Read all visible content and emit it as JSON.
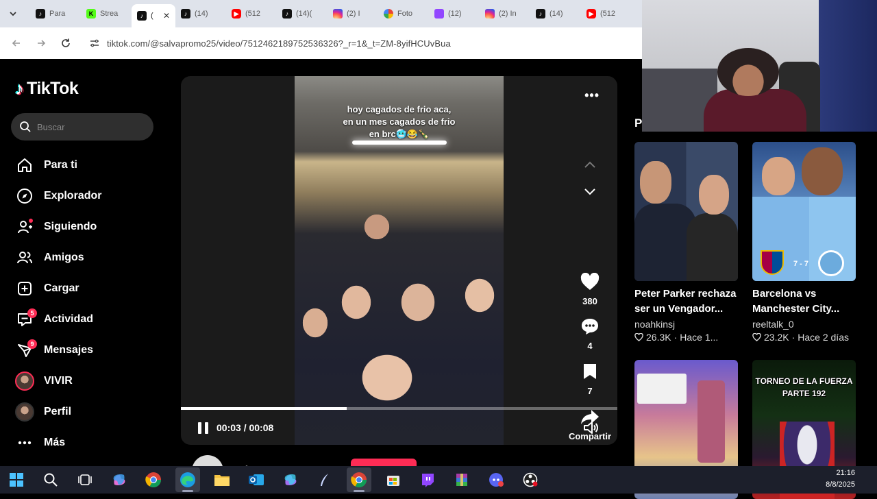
{
  "browser": {
    "tabs": [
      {
        "label": "Para",
        "icon": "tiktok"
      },
      {
        "label": "Strea",
        "icon": "kick"
      },
      {
        "label": "(",
        "icon": "tiktok",
        "active": true
      },
      {
        "label": "(14)",
        "icon": "tiktok"
      },
      {
        "label": "(512",
        "icon": "youtube"
      },
      {
        "label": "(14)(",
        "icon": "tiktok"
      },
      {
        "label": "(2) I",
        "icon": "instagram"
      },
      {
        "label": "Foto",
        "icon": "google-photos"
      },
      {
        "label": "(12)",
        "icon": "twitch"
      },
      {
        "label": "(2) In",
        "icon": "instagram"
      },
      {
        "label": "(14)",
        "icon": "tiktok"
      },
      {
        "label": "(512",
        "icon": "youtube"
      }
    ],
    "url": "tiktok.com/@salvapromo25/video/7512462189752536326?_r=1&_t=ZM-8yifHCUvBua"
  },
  "tiktok": {
    "logo_text": "TikTok",
    "search_placeholder": "Buscar",
    "nav": [
      {
        "label": "Para ti",
        "icon": "home-icon"
      },
      {
        "label": "Explorador",
        "icon": "compass-icon"
      },
      {
        "label": "Siguiendo",
        "icon": "following-icon",
        "dot": true
      },
      {
        "label": "Amigos",
        "icon": "friends-icon"
      },
      {
        "label": "Cargar",
        "icon": "upload-icon"
      },
      {
        "label": "Actividad",
        "icon": "activity-icon",
        "badge": "5"
      },
      {
        "label": "Mensajes",
        "icon": "messages-icon",
        "badge": "9"
      },
      {
        "label": "VIVIR",
        "icon": "live-avatar"
      },
      {
        "label": "Perfil",
        "icon": "profile-avatar"
      },
      {
        "label": "Más",
        "icon": "more-icon"
      }
    ]
  },
  "video": {
    "caption_lines": [
      "hoy cagados de frio aca,",
      "en un mes cagados de frio",
      "en brc🥶😂🍾"
    ],
    "likes": "380",
    "comments": "4",
    "saves": "7",
    "share_label": "Compartir",
    "time": "00:03 / 00:08",
    "progress": 0.38,
    "author": "salvapromo25"
  },
  "recommendations": {
    "heading": "P",
    "cards": [
      {
        "title_lines": [
          "Peter Parker rechaza",
          "ser un Vengador..."
        ],
        "author": "noahkinsj",
        "likes": "26.3K",
        "when": "Hace 1..."
      },
      {
        "title_lines": [
          "Barcelona vs",
          "Manchester City..."
        ],
        "author": "reeltalk_0",
        "likes": "23.2K",
        "when": "Hace 2 días",
        "score": "7 - 7"
      },
      {
        "title_lines": [],
        "author": "",
        "likes": "",
        "when": ""
      },
      {
        "title_lines": [],
        "author": "",
        "likes": "",
        "when": "",
        "thumb_text": [
          "TORNEO DE LA FUERZA",
          "PARTE 192"
        ]
      }
    ]
  },
  "taskbar": {
    "time": "21:16",
    "date": "8/8/2025"
  }
}
